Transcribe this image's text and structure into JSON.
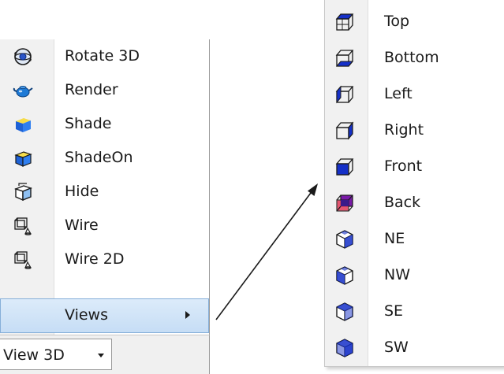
{
  "left_menu": {
    "items": [
      {
        "label": "Rotate 3D",
        "icon": "rotate-3d-icon"
      },
      {
        "label": "Render",
        "icon": "render-teapot-icon"
      },
      {
        "label": "Shade",
        "icon": "shade-icon"
      },
      {
        "label": "ShadeOn",
        "icon": "shade-on-icon"
      },
      {
        "label": "Hide",
        "icon": "hide-icon"
      },
      {
        "label": "Wire",
        "icon": "wire-icon"
      },
      {
        "label": "Wire 2D",
        "icon": "wire-2d-icon"
      },
      {
        "label": "Views",
        "icon": "",
        "highlighted": true
      }
    ]
  },
  "toolbar": {
    "dropdown_label": "View 3D"
  },
  "views_submenu": {
    "items": [
      {
        "label": "Top",
        "icon": "view-top-icon"
      },
      {
        "label": "Bottom",
        "icon": "view-bottom-icon"
      },
      {
        "label": "Left",
        "icon": "view-left-icon"
      },
      {
        "label": "Right",
        "icon": "view-right-icon"
      },
      {
        "label": "Front",
        "icon": "view-front-icon"
      },
      {
        "label": "Back",
        "icon": "view-back-icon"
      },
      {
        "label": "NE",
        "icon": "view-ne-icon"
      },
      {
        "label": "NW",
        "icon": "view-nw-icon"
      },
      {
        "label": "SE",
        "icon": "view-se-icon"
      },
      {
        "label": "SW",
        "icon": "view-sw-icon"
      }
    ]
  },
  "colors": {
    "highlight_fill": "#c6ddf5",
    "highlight_border": "#86afd9",
    "cube_blue": "#1530c8",
    "shade_yellow": "#f0d23a",
    "back_purple": "#7a1aa8"
  }
}
